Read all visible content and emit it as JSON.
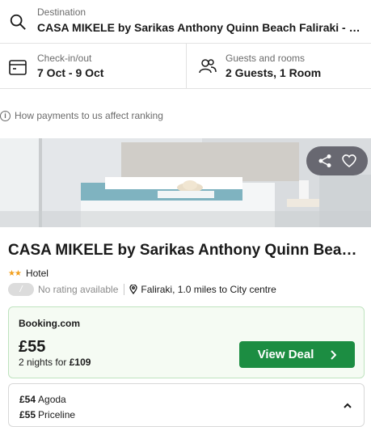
{
  "search": {
    "destination_label": "Destination",
    "destination_value": "CASA MIKELE by Sarikas Anthony Quinn Beach Faliraki - Rhodes",
    "dates_label": "Check-in/out",
    "dates_value": "7 Oct - 9 Oct",
    "guests_label": "Guests and rooms",
    "guests_value": "2 Guests, 1 Room"
  },
  "payments_note": "How payments to us affect ranking",
  "hotel": {
    "name": "CASA MIKELE by Sarikas Anthony Quinn Beach Faliraki",
    "type": "Hotel",
    "stars": 2,
    "rating_badge": "/",
    "rating_text": "No rating available",
    "location": "Faliraki, 1.0 miles to City centre"
  },
  "deal": {
    "provider": "Booking.com",
    "price": "£55",
    "nights_prefix": "2 nights for",
    "nights_total": "£109",
    "button_label": "View Deal"
  },
  "other_deals": [
    {
      "price": "£54",
      "provider": "Agoda"
    },
    {
      "price": "£55",
      "provider": "Priceline"
    }
  ],
  "icons": {
    "destination": "search-icon",
    "dates": "calendar-icon",
    "guests": "guests-icon",
    "info": "info-icon",
    "share": "share-icon",
    "favorite": "heart-icon",
    "location": "map-pin-icon",
    "chevron": "chevron-right-icon",
    "collapse": "chevron-up-icon"
  },
  "colors": {
    "accent_green": "#1c8d42",
    "deal_background": "#f5fbf3",
    "star": "#f2a01e"
  }
}
